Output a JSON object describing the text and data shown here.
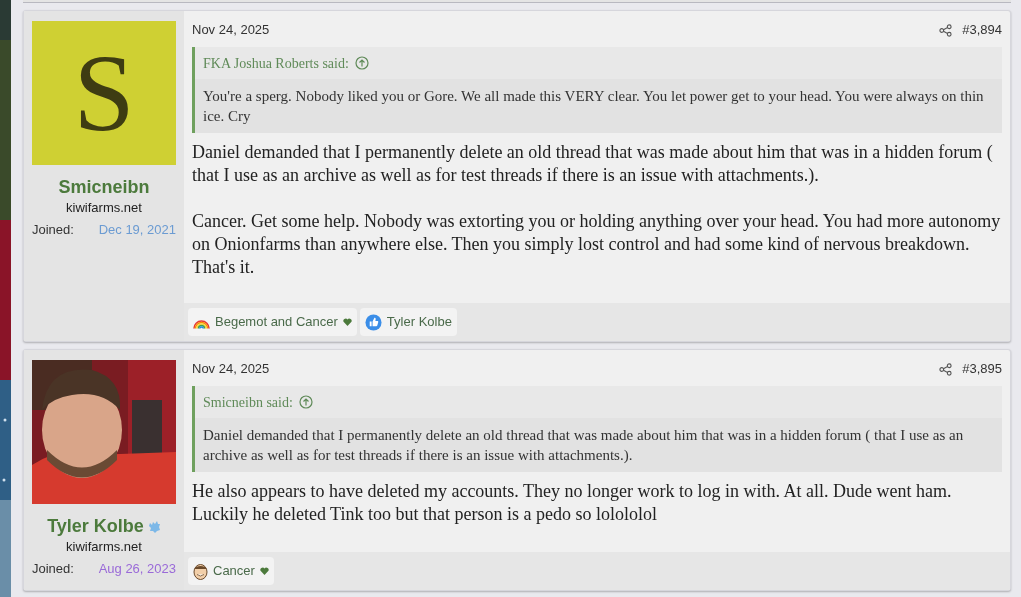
{
  "posts": [
    {
      "date": "Nov 24, 2025",
      "number": "#3,894",
      "user": {
        "name": "Smicneibn",
        "badge": false,
        "title": "kiwifarms.net",
        "joined": {
          "label": "Joined:",
          "date": "Dec 19, 2021",
          "color": "#6b9bd2"
        },
        "avatar": {
          "kind": "letter",
          "letter": "S",
          "color": "#cfd033"
        }
      },
      "quote": {
        "author": "FKA Joshua Roberts said:",
        "text": "You're a sperg. Nobody liked you or Gore. We all made this VERY clear. You let power get to your head. You were always on thin ice. Cry"
      },
      "paragraphs": [
        "Daniel demanded that I permanently delete an old thread that was made about him that was in a hidden forum ( that I use as an archive as well as for test threads if there is an issue with attachments.).",
        "Cancer. Get some help. Nobody was extorting you or holding anything over your head. You had more autonomy on Onionfarms than anywhere else. Then you simply lost control and had some kind of nervous breakdown. That's it."
      ],
      "reactions": [
        {
          "kind": "rainbow",
          "label": "Begemot and Cancer",
          "heart": true
        },
        {
          "kind": "like",
          "label": "Tyler Kolbe",
          "heart": false
        }
      ]
    },
    {
      "date": "Nov 24, 2025",
      "number": "#3,895",
      "user": {
        "name": "Tyler Kolbe",
        "badge": true,
        "title": "kiwifarms.net",
        "joined": {
          "label": "Joined:",
          "date": "Aug 26, 2023",
          "color": "#9a6ad8"
        }
      },
      "quote": {
        "author": "Smicneibn said:",
        "text": "Daniel demanded that I permanently delete an old thread that was made about him that was in a hidden forum ( that I use as an archive as well as for test threads if there is an issue with attachments.)."
      },
      "paragraphs": [
        "He also appears to have deleted my accounts. They no longer work to log in with. At all. Dude went ham. Luckily he deleted Tink too but that person is a pedo so lolololol"
      ],
      "reactions": [
        {
          "kind": "smiley",
          "label": "Cancer",
          "heart": true
        }
      ]
    }
  ]
}
